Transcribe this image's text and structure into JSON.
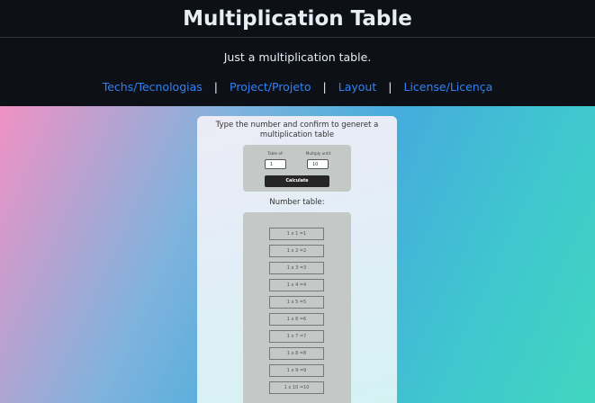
{
  "header": {
    "title": "Multiplication Table"
  },
  "subtitle": "Just a multiplication table.",
  "nav": {
    "items": [
      {
        "label": "Techs/Tecnologias"
      },
      {
        "label": "Project/Projeto"
      },
      {
        "label": "Layout"
      },
      {
        "label": "License/Licença"
      }
    ],
    "separator": "|"
  },
  "card": {
    "prompt": "Type the number and confirm to generet a multiplication table",
    "form": {
      "table_of_label": "Table of:",
      "table_of_value": "1",
      "multiply_until_label": "Multiply until:",
      "multiply_until_value": "10",
      "calculate_label": "Calculate"
    },
    "number_table_title": "Number table:",
    "rows": [
      "1 x 1 =1",
      "1 x 2 =2",
      "1 x 3 =3",
      "1 x 4 =4",
      "1 x 5 =5",
      "1 x 6 =6",
      "1 x 7 =7",
      "1 x 8 =8",
      "1 x 9 =9",
      "1 x 10 =10"
    ]
  },
  "colors": {
    "header_bg": "#0d1117",
    "link": "#2f81f7",
    "button_bg": "#262626",
    "panel_bg": "#c4c9c8"
  }
}
